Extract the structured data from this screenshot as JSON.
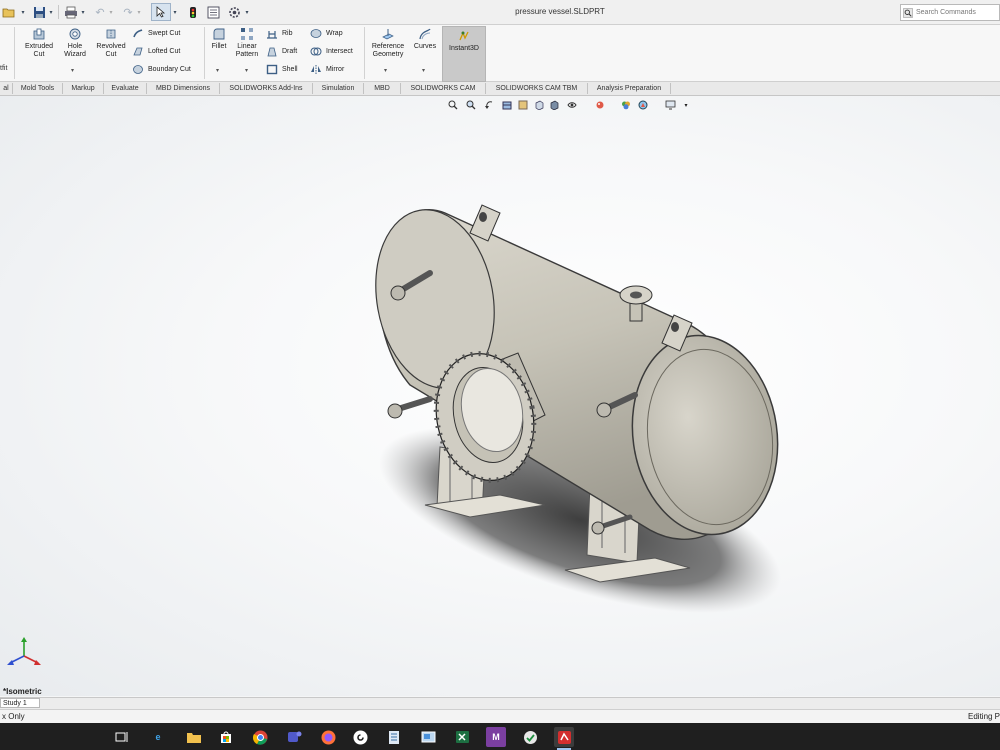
{
  "window": {
    "title": "pressure vessel.SLDPRT"
  },
  "search": {
    "placeholder": "Search Commands"
  },
  "ribbon": {
    "left_stub": "tfit",
    "extruded_cut": "Extruded\nCut",
    "hole_wizard": "Hole\nWizard",
    "revolved_cut": "Revolved\nCut",
    "swept_cut": "Swept Cut",
    "lofted_cut": "Lofted Cut",
    "boundary_cut": "Boundary Cut",
    "fillet": "Fillet",
    "linear_pattern": "Linear\nPattern",
    "rib": "Rib",
    "draft": "Draft",
    "shell": "Shell",
    "wrap": "Wrap",
    "intersect": "Intersect",
    "mirror": "Mirror",
    "reference_geometry": "Reference\nGeometry",
    "curves": "Curves",
    "instant3d": "Instant3D"
  },
  "tabs": [
    "al",
    "Mold Tools",
    "Markup",
    "Evaluate",
    "MBD Dimensions",
    "SOLIDWORKS Add-Ins",
    "Simulation",
    "MBD",
    "SOLIDWORKS CAM",
    "SOLIDWORKS CAM TBM",
    "Analysis Preparation"
  ],
  "viewport": {
    "view_label": "*Isometric"
  },
  "bottom_tabs": {
    "study": "Study 1"
  },
  "status": {
    "left": "x Only",
    "right": "Editing P"
  },
  "colors": {
    "accent": "#2f6db5",
    "model": "#c7c4b8",
    "taskbar": "#1f1f1f"
  }
}
